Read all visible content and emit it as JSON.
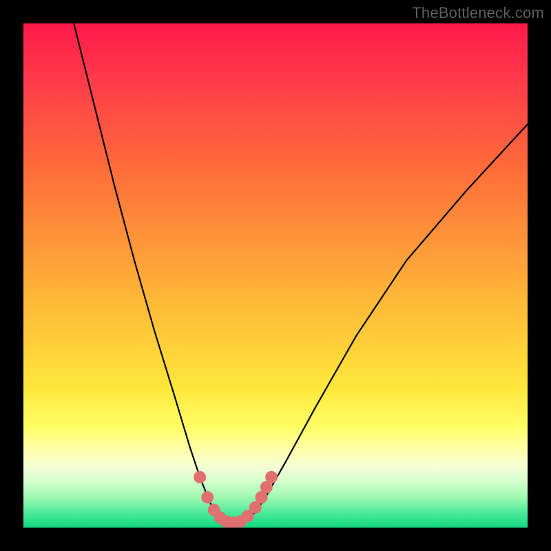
{
  "watermark": "TheBottleneck.com",
  "chart_data": {
    "type": "line",
    "title": "",
    "xlabel": "",
    "ylabel": "",
    "xlim": [
      0,
      100
    ],
    "ylim": [
      0,
      100
    ],
    "grid": false,
    "legend": false,
    "series": [
      {
        "name": "bottleneck-curve",
        "x": [
          10,
          14,
          18,
          22,
          26,
          30,
          33,
          35,
          37,
          38.5,
          40,
          42,
          44,
          46,
          48,
          52,
          58,
          66,
          76,
          88,
          100
        ],
        "y": [
          100,
          84,
          68,
          53,
          39,
          26,
          16,
          10,
          5,
          2.5,
          1,
          1,
          1.5,
          3,
          6,
          13,
          24,
          38,
          53,
          67,
          80
        ],
        "color": "#000000"
      }
    ],
    "markers": {
      "name": "highlight-dots",
      "color": "#e07070",
      "points": [
        {
          "x": 35.0,
          "y": 10.0
        },
        {
          "x": 36.5,
          "y": 6.0
        },
        {
          "x": 37.8,
          "y": 3.5
        },
        {
          "x": 39.0,
          "y": 2.0
        },
        {
          "x": 40.2,
          "y": 1.2
        },
        {
          "x": 41.5,
          "y": 1.0
        },
        {
          "x": 43.0,
          "y": 1.2
        },
        {
          "x": 44.5,
          "y": 2.3
        },
        {
          "x": 46.0,
          "y": 4.0
        },
        {
          "x": 47.2,
          "y": 6.0
        },
        {
          "x": 48.2,
          "y": 8.0
        },
        {
          "x": 49.2,
          "y": 10.0
        }
      ]
    },
    "background_gradient_stops": [
      {
        "pos": 0.0,
        "color": "#ff1a4a"
      },
      {
        "pos": 0.28,
        "color": "#ff6a3a"
      },
      {
        "pos": 0.55,
        "color": "#ffb838"
      },
      {
        "pos": 0.8,
        "color": "#ffff66"
      },
      {
        "pos": 0.9,
        "color": "#d2ffcc"
      },
      {
        "pos": 1.0,
        "color": "#11d880"
      }
    ]
  }
}
